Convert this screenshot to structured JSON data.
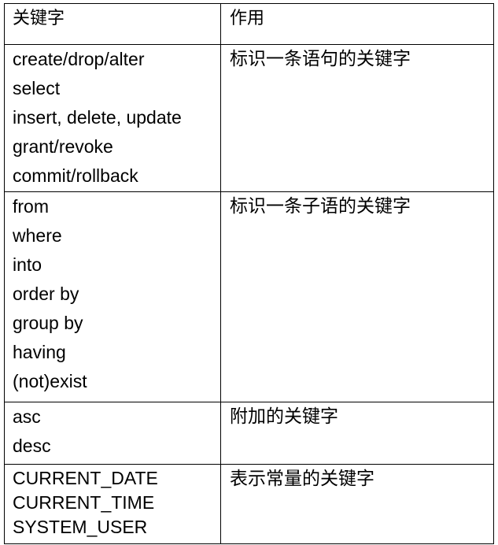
{
  "table": {
    "header": {
      "keyword": "关键字",
      "purpose": "作用"
    },
    "rows": [
      {
        "keywords": [
          "create/drop/alter",
          "select",
          "insert, delete, update",
          "grant/revoke",
          "commit/rollback"
        ],
        "purpose": "标识一条语句的关键字"
      },
      {
        "keywords": [
          "from",
          "where",
          "into",
          "order by",
          "group by",
          "having",
          "(not)exist"
        ],
        "purpose": "标识一条子语的关键字"
      },
      {
        "keywords": [
          "asc",
          "desc"
        ],
        "purpose": "附加的关键字"
      },
      {
        "keywords": [
          "CURRENT_DATE",
          "CURRENT_TIME",
          "SYSTEM_USER"
        ],
        "purpose": "表示常量的关键字"
      }
    ]
  }
}
